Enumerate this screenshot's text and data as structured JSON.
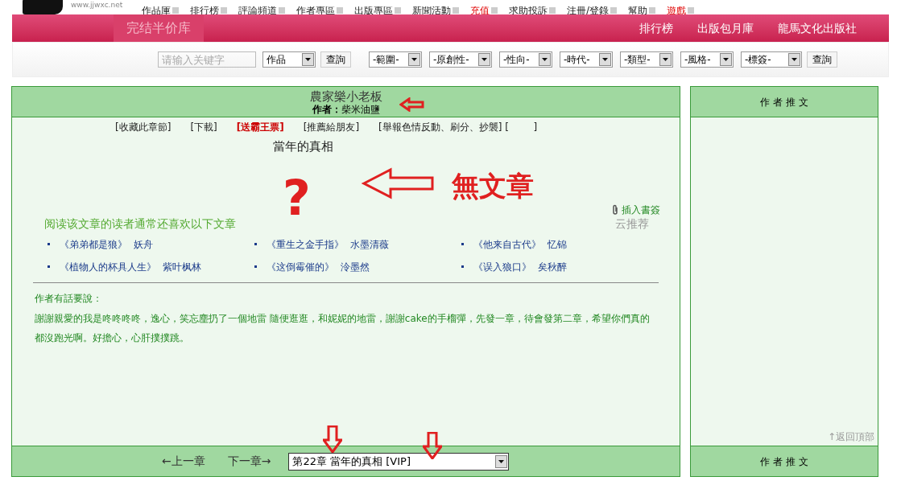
{
  "header": {
    "logo": "www.jjwxc.net",
    "nav": [
      {
        "label": "作品庫",
        "highlight": false
      },
      {
        "label": "排行榜",
        "highlight": false
      },
      {
        "label": "評論頻道",
        "highlight": false
      },
      {
        "label": "作者專區",
        "highlight": false
      },
      {
        "label": "出版專區",
        "highlight": false
      },
      {
        "label": "新聞活動",
        "highlight": false
      },
      {
        "label": "充值",
        "highlight": true
      },
      {
        "label": "求助投訴",
        "highlight": false
      },
      {
        "label": "注冊/登錄",
        "highlight": false
      },
      {
        "label": "幫助",
        "highlight": false
      },
      {
        "label": "遊戲",
        "highlight": true
      }
    ],
    "banner_tab": "完结半价库",
    "banner_links": [
      "排行榜",
      "出版包月庫",
      "龍馬文化出版社"
    ]
  },
  "search": {
    "placeholder": "请输入关键字",
    "type_select": "作品",
    "button": "查詢",
    "filters": [
      "-範圍-",
      "-原創性-",
      "-性向-",
      "-時代-",
      "-類型-",
      "-風格-",
      "-標簽-"
    ],
    "filter_button": "查詢"
  },
  "chapter": {
    "novel_title": "農家樂小老板",
    "author_label": "作者：",
    "author": "柴米油鹽",
    "actions": [
      {
        "label": "[收藏此章節]",
        "kind": "plain"
      },
      {
        "label": "[下載]",
        "kind": "plain"
      },
      {
        "label": "[送霸王票]",
        "kind": "bold"
      },
      {
        "label": "[推薦給朋友]",
        "kind": "plain"
      },
      {
        "label": "[舉報色情反動、刷分、抄襲] [        ]",
        "kind": "plain"
      }
    ],
    "chapter_title": "當年的真相",
    "annotation": "無文章",
    "annotation_mark": "?",
    "bookmark": "插入書簽",
    "recommend_heading": "阅读该文章的读者通常还喜欢以下文章",
    "cloud": "云推荐",
    "recommendations": [
      {
        "title": "《弟弟都是狼》",
        "author": "妖舟"
      },
      {
        "title": "《重生之金手指》",
        "author": "水墨清薇"
      },
      {
        "title": "《他来自古代》",
        "author": "忆锦"
      },
      {
        "title": "《植物人的杯具人生》",
        "author": "紫叶枫林"
      },
      {
        "title": "《这倒霉催的》",
        "author": "泠墨然"
      },
      {
        "title": "《误入狼口》",
        "author": "矣秋醉"
      }
    ],
    "note_heading": "作者有話要說：",
    "note": "謝謝親愛的我是咚咚咚咚，逸心，笑忘塵扔了一個地雷 隨便逛逛，和妮妮的地雷，謝謝cake的手榴彈，先發一章，待會發第二章，希望你們真的都沒跑光啊。好擔心，心肝撲撲跳。",
    "prev": "←上一章",
    "next": "下一章→",
    "chapter_select": "第22章 當年的真相 [VIP]"
  },
  "sidebar": {
    "title": "作 者 推 文",
    "back_to_top": "↑返回頂部",
    "footer_title": "作 者 推 文"
  }
}
